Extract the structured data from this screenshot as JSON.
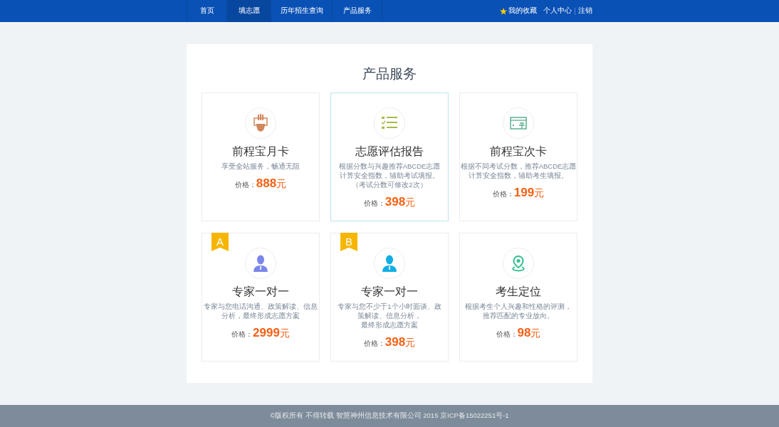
{
  "nav": {
    "items": [
      {
        "label": "首页",
        "selected": false
      },
      {
        "label": "填志愿",
        "selected": true
      },
      {
        "label": "历年招生查询",
        "selected": false
      },
      {
        "label": "产品服务",
        "selected": false
      }
    ],
    "user_links": [
      "我的收藏",
      "个人中心",
      "注销"
    ]
  },
  "page_title": "产品服务",
  "cards": [
    {
      "title": "前程宝月卡",
      "description": [
        "享受全站服务，畅通无阻"
      ],
      "price_label": "价格：",
      "price": "888",
      "unit": "元",
      "selected": false
    },
    {
      "title": "志愿评估报告",
      "description": [
        "根据分数与兴趣推荐ABCDE志愿",
        "计算安全指数，辅助考试填报。",
        "（考试分数可修改2次）"
      ],
      "price_label": "价格：",
      "price": "398",
      "unit": "元",
      "selected": true
    },
    {
      "title": "前程宝次卡",
      "description": [
        "根据不同考试分数，推荐ABCDE志愿",
        "计算安全指数，辅助考生填报。"
      ],
      "price_label": "价格：",
      "price": "199",
      "unit": "元",
      "selected": false
    },
    {
      "badge": "A",
      "title": "专家一对一",
      "description": [
        "专家与您电话沟通、政策解读、信息",
        "分析，最终形成志愿方案"
      ],
      "price_label": "价格：",
      "price": "2999",
      "unit": "元",
      "selected": false
    },
    {
      "badge": "B",
      "title": "专家一对一",
      "description": [
        "专家与您不少于1个小时面谈、政",
        "策解读、信息分析，",
        "最终形成志愿方案"
      ],
      "price_label": "价格：",
      "price": "398",
      "unit": "元",
      "selected": false
    },
    {
      "title": "考生定位",
      "description": [
        "根据考生个人兴趣和性格的评测，",
        "推荐匹配的专业放向。"
      ],
      "price_label": "价格：",
      "price": "98",
      "unit": "元",
      "selected": false
    }
  ],
  "footer": "©版权所有 不得转载 智慧神州信息技术有限公司 2015 京ICP备15022251号-1"
}
